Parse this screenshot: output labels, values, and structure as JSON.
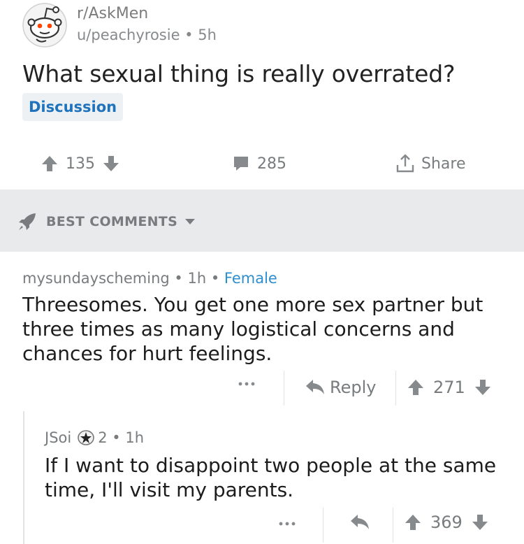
{
  "post": {
    "subreddit_prefix": "r/",
    "subreddit_name": "AskMen",
    "author_line": "u/peachyrosie • 5h",
    "title": "What sexual thing is really overrated?",
    "flair": "Discussion",
    "score": "135",
    "comments": "285",
    "share_label": "Share"
  },
  "sort": {
    "label": "BEST COMMENTS"
  },
  "comments": [
    {
      "author": "mysundayscheming",
      "time": "1h",
      "flair": "Female",
      "body": "Threesomes. You get one more sex partner but three times as many logistical concerns and chances for hurt feelings.",
      "reply_label": "Reply",
      "score": "271"
    },
    {
      "author": "JSoi",
      "award_count": "2",
      "time": "1h",
      "body": "If I want to disappoint two people at the same time, I'll visit my parents.",
      "score": "369"
    }
  ],
  "icons": {
    "avatar": "snoo-avatar-icon",
    "upvote": "upvote-arrow-icon",
    "downvote": "downvote-arrow-icon",
    "comment": "comment-bubble-icon",
    "share": "share-icon",
    "sort": "rocket-icon",
    "caret": "caret-down-icon",
    "more": "more-dots-icon",
    "reply": "reply-arrow-icon",
    "award": "star-award-icon"
  },
  "colors": {
    "flair_text": "#1f73bd",
    "user_flair": "#2d8fd0",
    "muted": "#787c7e",
    "sort_bar": "#e9eaeb"
  }
}
